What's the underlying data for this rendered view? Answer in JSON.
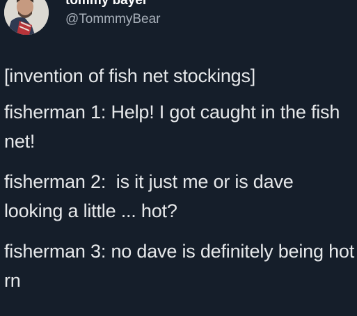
{
  "tweet": {
    "author": {
      "display_name": "tommy bayer",
      "handle": "@TommmyBear",
      "avatar_icon": "profile-photo"
    },
    "paragraphs": [
      "[invention of fish net stockings]",
      "fisherman 1: Help! I got caught in the fish net!",
      "fisherman 2:  is it just me or is dave looking a little ... hot?",
      "fisherman 3: no dave is definitely being hot rn"
    ]
  },
  "colors": {
    "background": "#151e2a",
    "text": "#e6e8ea",
    "handle": "#a9b1bb"
  }
}
